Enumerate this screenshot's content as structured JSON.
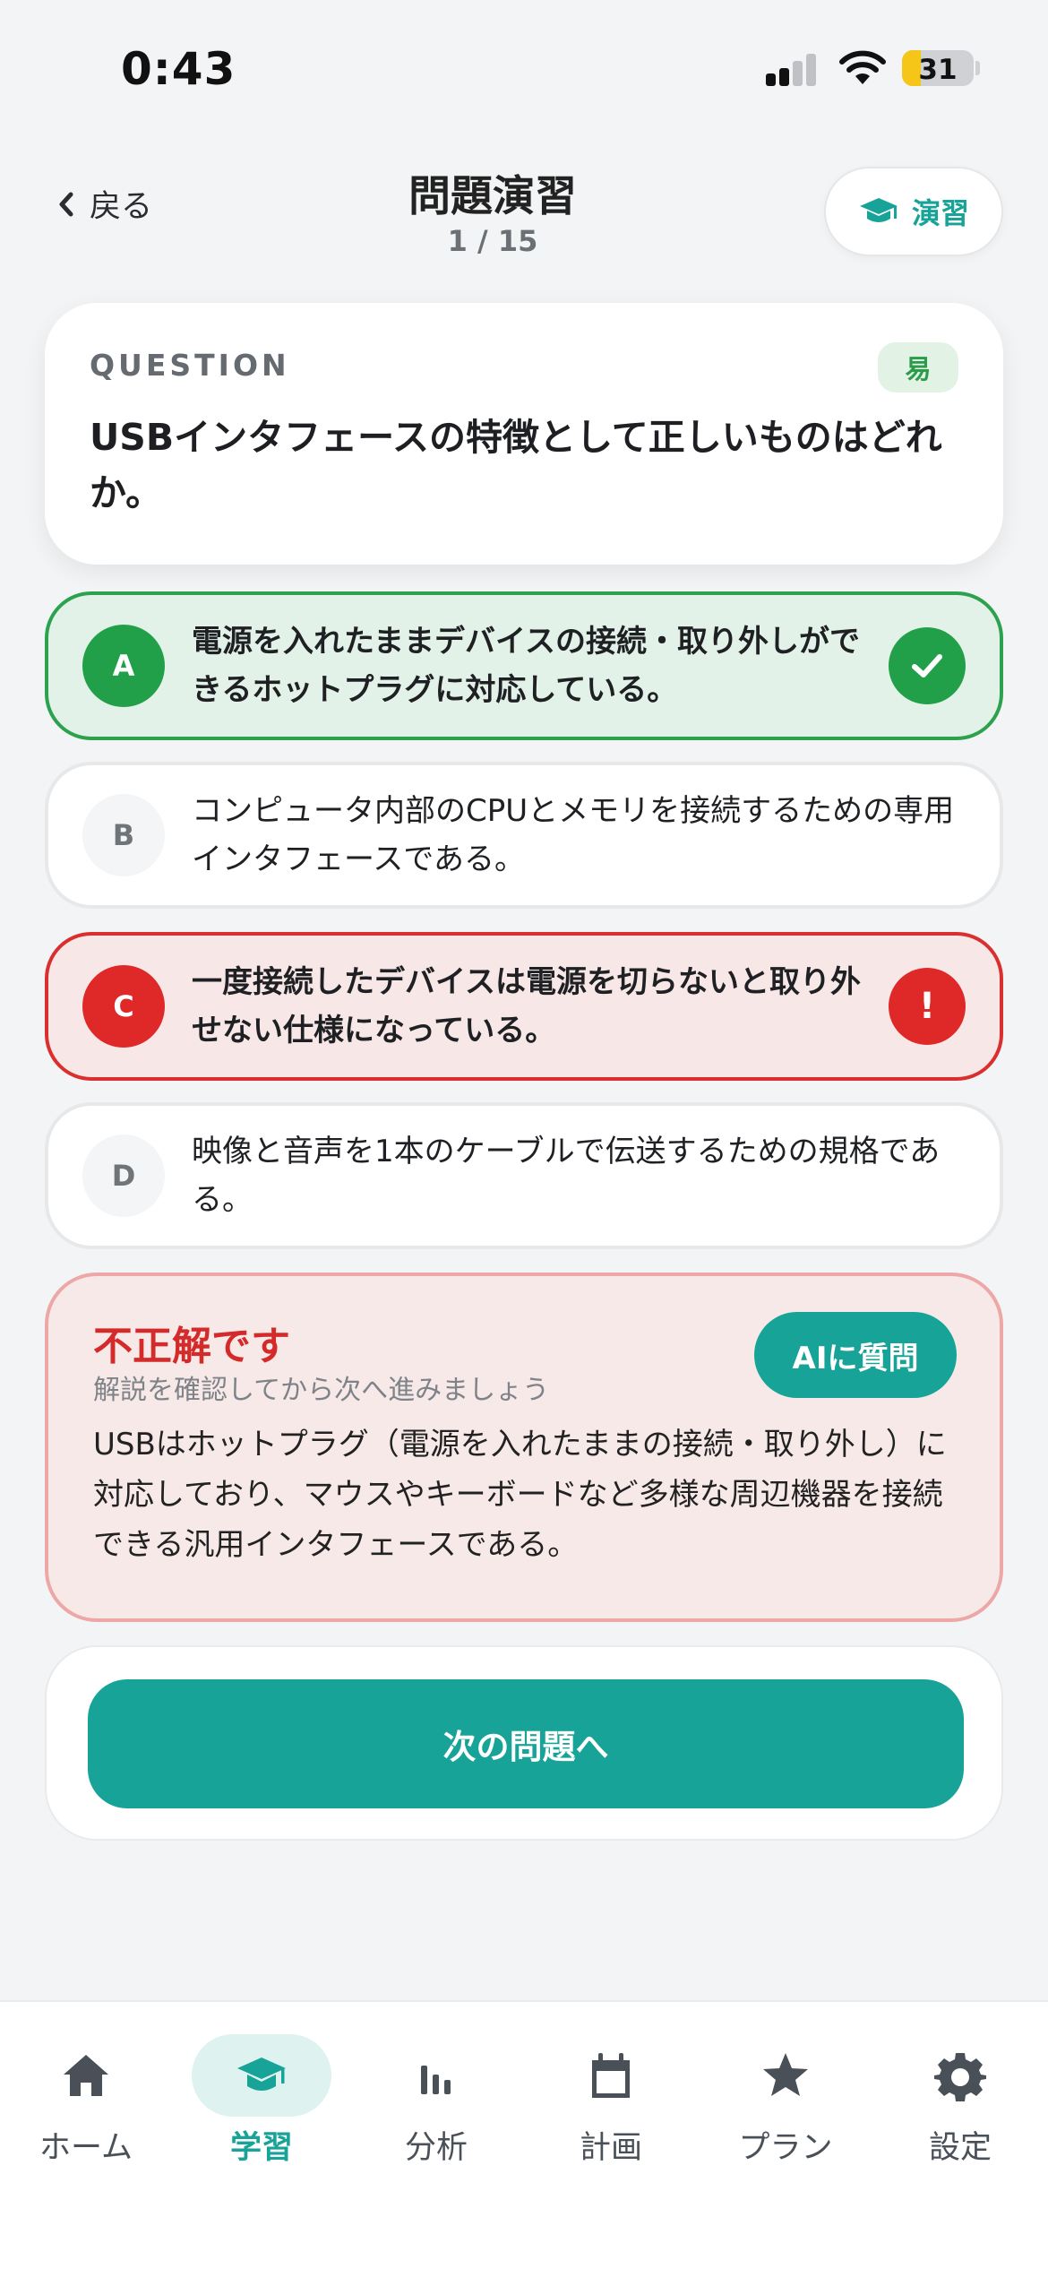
{
  "status": {
    "time": "0:43",
    "battery": "31"
  },
  "header": {
    "back_label": "戻る",
    "title": "問題演習",
    "progress": "1 / 15",
    "mode_button": "演習"
  },
  "question": {
    "label": "QUESTION",
    "difficulty": "易",
    "text": "USBインタフェースの特徴として正しいものはどれか。"
  },
  "options": [
    {
      "letter": "A",
      "text": "電源を入れたままデバイスの接続・取り外しができるホットプラグに対応している。",
      "state": "correct"
    },
    {
      "letter": "B",
      "text": "コンピュータ内部のCPUとメモリを接続するための専用インタフェースである。",
      "state": "neutral"
    },
    {
      "letter": "C",
      "text": "一度接続したデバイスは電源を切らないと取り外せない仕様になっている。",
      "state": "wrong",
      "mark": "!"
    },
    {
      "letter": "D",
      "text": "映像と音声を1本のケーブルで伝送するための規格である。",
      "state": "neutral"
    }
  ],
  "feedback": {
    "title": "不正解です",
    "subtitle": "解説を確認してから次へ進みましょう",
    "ai_button": "AIに質問",
    "explanation": "USBはホットプラグ（電源を入れたままの接続・取り外し）に対応しており、マウスやキーボードなど多様な周辺機器を接続できる汎用インタフェースである。"
  },
  "next_button": "次の問題へ",
  "tabs": [
    {
      "label": "ホーム",
      "icon": "home-icon"
    },
    {
      "label": "学習",
      "icon": "graduation-cap-icon",
      "active": true
    },
    {
      "label": "分析",
      "icon": "bar-chart-icon"
    },
    {
      "label": "計画",
      "icon": "calendar-icon"
    },
    {
      "label": "プラン",
      "icon": "star-icon"
    },
    {
      "label": "設定",
      "icon": "gear-icon"
    }
  ],
  "colors": {
    "accent": "#17a397",
    "correct": "#21a049",
    "wrong": "#df2828",
    "background": "#f3f4f5"
  }
}
